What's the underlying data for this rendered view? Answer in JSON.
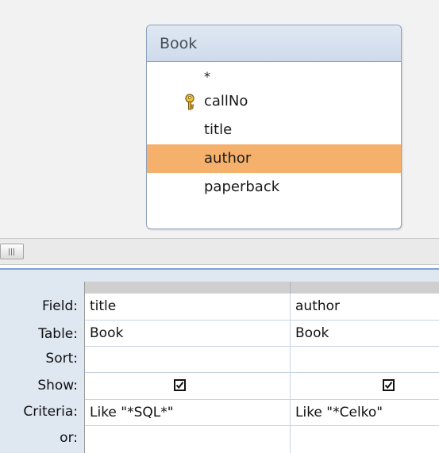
{
  "table_box": {
    "title": "Book",
    "fields": [
      {
        "label": "*",
        "primary_key": false,
        "selected": false
      },
      {
        "label": "callNo",
        "primary_key": true,
        "selected": false
      },
      {
        "label": "title",
        "primary_key": false,
        "selected": false
      },
      {
        "label": "author",
        "primary_key": false,
        "selected": true
      },
      {
        "label": "paperback",
        "primary_key": false,
        "selected": false
      }
    ]
  },
  "grid": {
    "row_labels": {
      "field": "Field:",
      "table": "Table:",
      "sort": "Sort:",
      "show": "Show:",
      "criteria": "Criteria:",
      "or": "or:"
    },
    "columns": [
      {
        "field": "title",
        "table": "Book",
        "sort": "",
        "show": true,
        "criteria": "Like \"*SQL*\"",
        "or": ""
      },
      {
        "field": "author",
        "table": "Book",
        "sort": "",
        "show": true,
        "criteria": "Like \"*Celko\"",
        "or": ""
      }
    ]
  },
  "colors": {
    "selected_field": "#f5b16c",
    "title_bar": "#cfdbec",
    "grid_background": "#dfe7f1"
  },
  "icons": {
    "primary_key": "key-icon",
    "checkbox_checked": "checkbox-checked-icon"
  }
}
